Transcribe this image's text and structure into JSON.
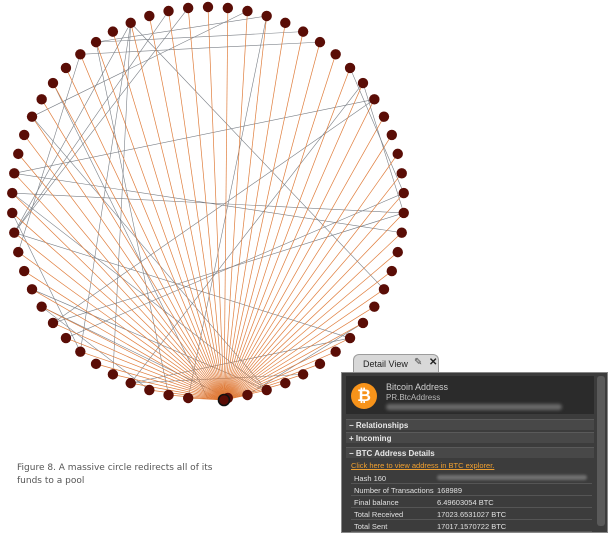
{
  "caption": "Figure 8. A massive circle redirects all of its funds to a pool",
  "graph": {
    "node_count": 62,
    "node_color": "#5a0d06",
    "edge_orange": "#e07d3c",
    "edge_gray": "#7a7f86",
    "hub_node": "pool"
  },
  "detail_view": {
    "tab_label": "Detail View",
    "pin_icon": "pin-icon",
    "close_icon": "close-icon",
    "coin_symbol": "₿",
    "title": "Bitcoin Address",
    "subtitle": "PR.BtcAddress",
    "sections": {
      "relationships": "− Relationships",
      "incoming": "+ Incoming",
      "details": "− BTC Address Details"
    },
    "explorer_link": "Click here to view address in BTC explorer.",
    "rows": [
      {
        "label": "Hash 160",
        "value": ""
      },
      {
        "label": "Number of Transactions",
        "value": "168989"
      },
      {
        "label": "Final balance",
        "value": "6.49603054 BTC"
      },
      {
        "label": "Total Received",
        "value": "17023.6531027 BTC"
      },
      {
        "label": "Total Sent",
        "value": "17017.1570722 BTC"
      }
    ]
  }
}
